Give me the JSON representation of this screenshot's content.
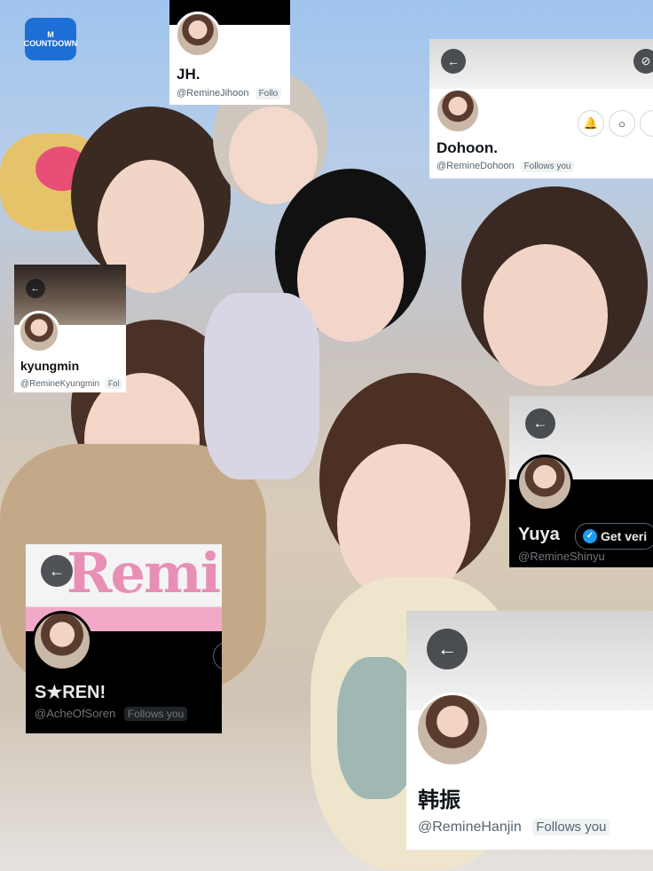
{
  "photo_logo": "M COUNTDOWN",
  "cards": {
    "jh": {
      "name": "JH.",
      "handle": "@RemineJihoon",
      "follows": "Follo"
    },
    "dohoon": {
      "name": "Dohoon.",
      "handle": "@RemineDohoon",
      "follows": "Follows you"
    },
    "kyungmin": {
      "name": "kyungmin",
      "handle": "@RemineKyungmin",
      "follows": "Fol"
    },
    "yuya": {
      "name": "Yuya",
      "handle": "@RemineShinyu",
      "verify_label": "Get veri"
    },
    "soren": {
      "name": "S★REN!",
      "handle": "@AcheOfSoren",
      "follows": "Follows you",
      "banner_text": "Remi"
    },
    "hanjin": {
      "name": "韩振",
      "handle": "@RemineHanjin",
      "follows": "Follows you"
    }
  },
  "colors": {
    "verified": "#1d9bf0",
    "banner_pink": "#f2a9c8"
  },
  "icons": [
    "back-arrow-icon",
    "notification-add-icon",
    "message-icon",
    "more-icon",
    "verified-badge-icon"
  ]
}
